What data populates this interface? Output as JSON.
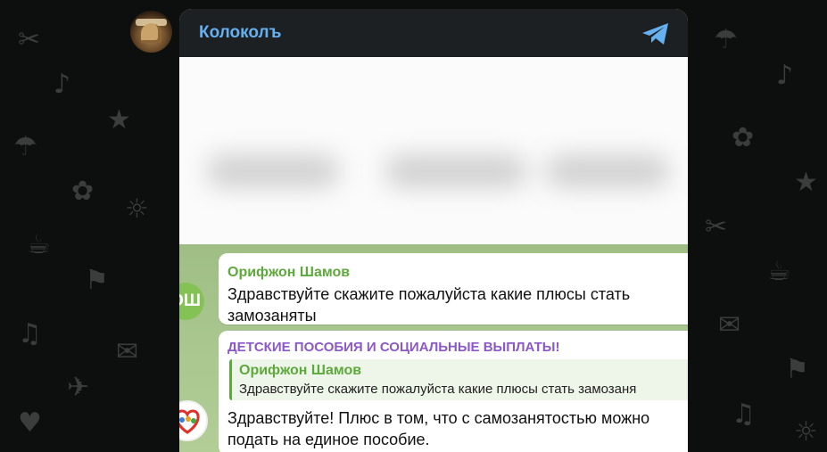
{
  "header": {
    "channel_title": "Колоколъ",
    "channel_icon": "telegram-plane-icon",
    "accent_color": "#66b0f0"
  },
  "messages": [
    {
      "author": "Орифжон Шамов",
      "avatar_initials": "ОШ",
      "text_line1": "Здравствуйте скажите пожалуйста какие плюсы стать",
      "text_line2": "замозаняты"
    },
    {
      "channel_name": "ДЕТСКИЕ ПОСОБИЯ И СОЦИАЛЬНЫЕ ВЫПЛАТЫ!",
      "reply_author": "Орифжон Шамов",
      "reply_text": "Здравствуйте скажите пожалуйста какие плюсы стать замозаня",
      "text_line1": "Здравствуйте! Плюс в том, что с самозанятостью можно",
      "text_line2": "подать на единое пособие."
    }
  ]
}
